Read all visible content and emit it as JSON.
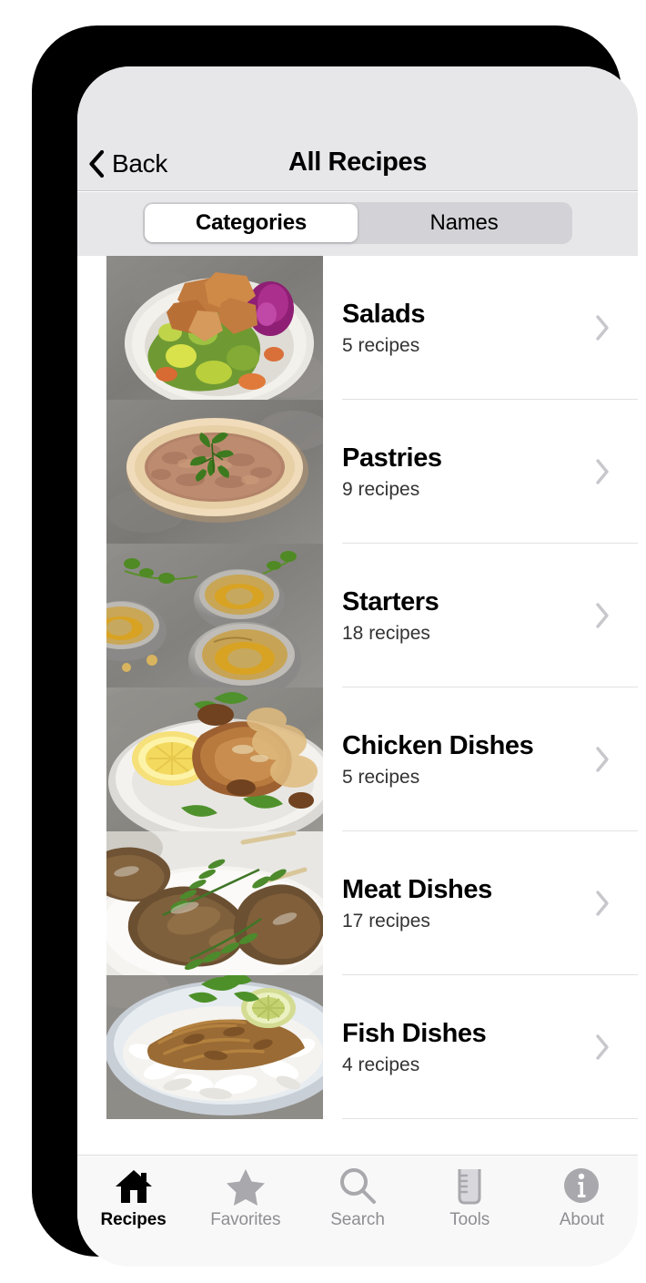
{
  "nav": {
    "back_label": "Back",
    "back_icon": "chevron-left-icon",
    "title": "All Recipes"
  },
  "segmented_control": {
    "selected": "Categories",
    "options": [
      {
        "label": "Categories",
        "selected": true
      },
      {
        "label": "Names",
        "selected": false
      }
    ]
  },
  "list": {
    "rows": [
      {
        "title": "Salads",
        "subtitle": "5 recipes",
        "thumb": "fattoush-salad-photo",
        "chevron": "chevron-right-icon"
      },
      {
        "title": "Pastries",
        "subtitle": "9 recipes",
        "thumb": "meat-flatbread-photo",
        "chevron": "chevron-right-icon"
      },
      {
        "title": "Starters",
        "subtitle": "18 recipes",
        "thumb": "hummus-bowls-photo",
        "chevron": "chevron-right-icon"
      },
      {
        "title": "Chicken Dishes",
        "subtitle": "5 recipes",
        "thumb": "roast-chicken-photo",
        "chevron": "chevron-right-icon"
      },
      {
        "title": "Meat Dishes",
        "subtitle": "17 recipes",
        "thumb": "kafta-skewers-photo",
        "chevron": "chevron-right-icon"
      },
      {
        "title": "Fish Dishes",
        "subtitle": "4 recipes",
        "thumb": "fish-with-rice-photo",
        "chevron": "chevron-right-icon"
      }
    ]
  },
  "tab_bar": {
    "items": [
      {
        "label": "Recipes",
        "icon": "home-icon",
        "active": true
      },
      {
        "label": "Favorites",
        "icon": "star-icon",
        "active": false
      },
      {
        "label": "Search",
        "icon": "search-icon",
        "active": false
      },
      {
        "label": "Tools",
        "icon": "measuring-cup-icon",
        "active": false
      },
      {
        "label": "About",
        "icon": "info-circle-icon",
        "active": false
      }
    ]
  },
  "colors": {
    "nav_background": "#e7e7ea",
    "segment_track": "#d3d2d7",
    "segment_selected": "#ffffff",
    "tab_inactive": "#8e8e93",
    "tab_active": "#000000",
    "divider": "#e2e2e4",
    "chevron": "#c7c7cc",
    "frame": "#000000"
  }
}
